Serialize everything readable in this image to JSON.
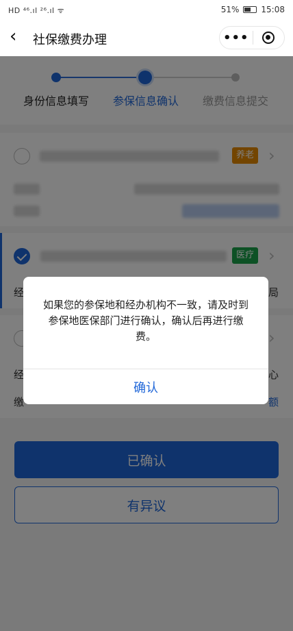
{
  "status_bar": {
    "left": "HD ⁴⁶.ıl ²⁶.ıl ᯤ",
    "battery_text": "51%",
    "time": "15:08"
  },
  "nav": {
    "back_icon": "‹",
    "title": "社保缴费办理",
    "more_icon": "•••"
  },
  "steps": [
    {
      "label": "身份信息填写",
      "state": "done"
    },
    {
      "label": "参保信息确认",
      "state": "active"
    },
    {
      "label": "缴费信息提交",
      "state": "pending"
    }
  ],
  "cards": [
    {
      "tag": "养老",
      "tag_color": "#e68a00",
      "checked": false
    },
    {
      "tag": "医疗",
      "tag_color": "#1aa34a",
      "checked": true,
      "row_left": "经",
      "row_right": "局"
    },
    {
      "checked": false,
      "row1_left": "经",
      "row1_right": "心",
      "row2_left": "缴",
      "row2_right": "额"
    }
  ],
  "buttons": {
    "confirmed": "已确认",
    "objection": "有异议"
  },
  "dialog": {
    "message": "如果您的参保地和经办机构不一致，请及时到参保地医保部门进行确认，确认后再进行缴费。",
    "confirm": "确认"
  },
  "colors": {
    "primary": "#1f66d8",
    "orange_tag": "#e68a00",
    "green_tag": "#1aa34a"
  },
  "icons": [
    "back-icon",
    "more-icon",
    "target-icon",
    "check-icon",
    "chevron-right-icon"
  ]
}
